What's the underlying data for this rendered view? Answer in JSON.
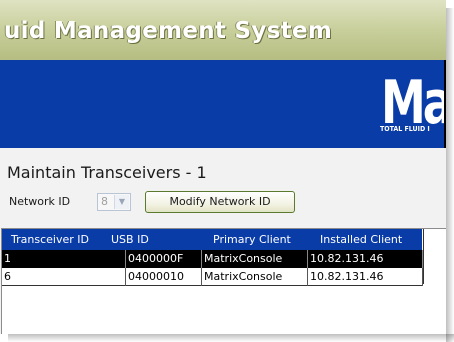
{
  "window": {
    "title": "uid Management System"
  },
  "banner": {
    "logo_text": "Ma",
    "tagline": "TOTAL FLUID I",
    "color": "#0a3ca8"
  },
  "section": {
    "title": "Maintain Transceivers - 1"
  },
  "network": {
    "label": "Network ID",
    "selected": "8",
    "modify_label": "Modify Network ID"
  },
  "grid": {
    "columns": [
      "Transceiver ID",
      "USB ID",
      "Primary Client",
      "Installed Client"
    ],
    "rows": [
      {
        "transceiver_id": "1",
        "usb_id": "0400000F",
        "primary_client": "MatrixConsole",
        "installed_client": "10.82.131.46",
        "selected": true
      },
      {
        "transceiver_id": "6",
        "usb_id": "04000010",
        "primary_client": "MatrixConsole",
        "installed_client": "10.82.131.46",
        "selected": false
      }
    ]
  },
  "colors": {
    "header_bg": "#0a3ca8",
    "selected_row_bg": "#000000",
    "title_bar": "#c8cf9b"
  }
}
